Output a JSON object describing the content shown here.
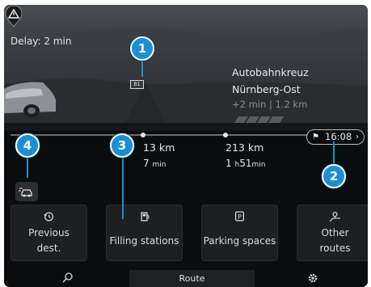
{
  "route": {
    "delay": "Delay: 2 min",
    "road_sign": "B1",
    "destination": "Autobahnkreuz Nürnberg-Ost",
    "destination_sub": "+2 min | 1.2 km",
    "eta": "16:08",
    "segments": [
      {
        "distance": "13 km",
        "time_value": "7",
        "time_unit": "min"
      },
      {
        "distance": "213 km",
        "time_hours": "1",
        "time_hours_unit": "h",
        "time_minutes": "51",
        "time_minutes_unit": "min"
      }
    ]
  },
  "callouts": [
    "1",
    "2",
    "3",
    "4"
  ],
  "quick_actions": [
    {
      "label": "Previous dest.",
      "line1": "Previous",
      "line2": "dest.",
      "icon": "history-icon"
    },
    {
      "label": "Filling stations",
      "icon": "fuel-pump-icon"
    },
    {
      "label": "Parking spaces",
      "icon": "parking-icon"
    },
    {
      "label": "Other routes",
      "line1": "Other",
      "line2": "routes",
      "icon": "alternate-routes-icon"
    }
  ],
  "bottom_nav": {
    "search_icon": "search-icon",
    "route_label": "Route",
    "settings_icon": "gear-icon"
  },
  "colors": {
    "callout": "#1a90d2",
    "background": "#0b0c0e",
    "button": "#1d1f22"
  }
}
